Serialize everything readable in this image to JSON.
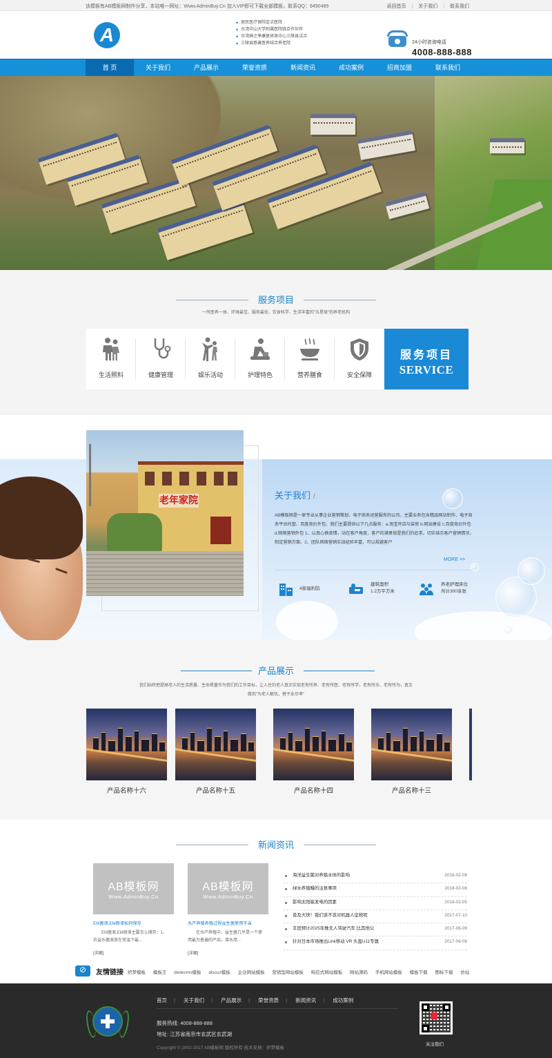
{
  "topbar": {
    "left_text": "该模板有AB模板网制作分享，本站唯一网址：Www.AdminBuy.Cn 加入VIP即可下载全部模板，联系QQ：9490489",
    "links": [
      "返回首页",
      "关于我们",
      "联系我们"
    ]
  },
  "header": {
    "logo_letter": "A",
    "tags": [
      "居民医疗保险定点医院",
      "台湾中山大学附属医院临合作伙伴",
      "台湾禅之季康复研发中心三陵县试点",
      "三陵县慈善医养结合养老院"
    ],
    "phone_label": "24小时咨询电话",
    "phone": "4008-888-888"
  },
  "nav": {
    "items": [
      "首 页",
      "关于我们",
      "产品展示",
      "荣誉资质",
      "新闻资讯",
      "成功案例",
      "招商加盟",
      "联系我们"
    ],
    "active_index": 0
  },
  "services": {
    "title": "服务项目",
    "subtitle": "一所医养一体、环境最佳、服务最优、饮食科学、生活丰富的\"五星级\"的养老机构",
    "items": [
      {
        "label": "生活照料",
        "icon": "people-icon"
      },
      {
        "label": "健康管理",
        "icon": "stethoscope-icon"
      },
      {
        "label": "娱乐活动",
        "icon": "dance-icon"
      },
      {
        "label": "护理特色",
        "icon": "nursing-icon"
      },
      {
        "label": "营养膳食",
        "icon": "meal-icon"
      },
      {
        "label": "安全保障",
        "icon": "shield-icon"
      }
    ],
    "banner_cn": "服务项目",
    "banner_en": "SERVICE"
  },
  "about": {
    "title": "关于我们",
    "slash": "/",
    "text": "AB模板网是一家专业从事企业营销策划、电子商务运营服务的公司，主要业务包含精品网站制作、电子商务平台托管、百度竞价外包、我们主要提供以下几点服务：a.淘宝开店与装修 b.网站建设 c.百度竞价外包 d.网络营销外包 1、以真心换真情，站在客户角度，客户的满意就是我们的追求，切实结合客户营销情况，制定营销方案。2、团队网络营销实战经验丰富，可以规避客户",
    "more": "MORE >>",
    "sign_text": "老年家院",
    "stats": [
      {
        "line1": "4家福利院",
        "line2": "",
        "icon": "building-icon"
      },
      {
        "line1": "建筑面积",
        "line2": "1.2万平方米",
        "icon": "bed-icon"
      },
      {
        "line1": "养老护理床位",
        "line2": "共计300余张",
        "icon": "group-icon"
      }
    ]
  },
  "products": {
    "title": "产品展示",
    "desc": "我们始终把提高老人的生活质量、生命质量作为我们的工作目标，让入住的老人真正实现老有所养、老有所医、老有所学、老有所乐、老有所为，真正做到\"为老人解忧，替子女尽孝\"",
    "items": [
      "产品名称十六",
      "产品名称十五",
      "产品名称十四",
      "产品名称十三"
    ]
  },
  "news": {
    "title": "新闻资讯",
    "thumbs": [
      {
        "t1": "AB模板网",
        "t2": "Www.AdminBuy.Cn",
        "title": "EM菌液,EM原液如何保存",
        "desc": "EM菌液,EM原液主要怎么储存：1、农益乐菌液放在常温下最...",
        "more": "[详细]"
      },
      {
        "t1": "AB模板网",
        "t2": "Www.AdminBuy.Cn",
        "title": "水产养殖养殖过程益生菌使用不当",
        "desc": "在水产养殖中，益生菌几乎是一个使用最为普遍的产品，增水用...",
        "more": "[详细]"
      }
    ],
    "list": [
      {
        "title": "海洋益生菌对养殖水体的影响",
        "date": "2018-02-08"
      },
      {
        "title": "绿水养殖鳗的注意事项",
        "date": "2018-02-08"
      },
      {
        "title": "影响太阳能发电的因素",
        "date": "2018-02-05"
      },
      {
        "title": "普及大快！我们该不该对机器人征税呢",
        "date": "2017-07-10"
      },
      {
        "title": "丰田预计2025年推无人驾驶汽车 比其他公",
        "date": "2017-06-09"
      },
      {
        "title": "针对日本市场推出Link移动 VR 头盔U11专属",
        "date": "2017-06-09"
      }
    ]
  },
  "links": {
    "title": "友情链接",
    "items": [
      "织梦模板",
      "模板王",
      "dedecms模板",
      "discuz模板",
      "企业网站模板",
      "营销型网站模板",
      "响应式网站模板",
      "网站源码",
      "手机网站模板",
      "模板下载",
      "图标下载",
      "仿站"
    ]
  },
  "footer": {
    "nav": [
      "首页",
      "关于我们",
      "产品展示",
      "荣誉资质",
      "新闻资讯",
      "成功案例"
    ],
    "hotline_label": "服务热线:",
    "hotline": "4008-888-888",
    "address_label": "地址:",
    "address": "江苏省南京市玄武区玄武湖",
    "copyright": "Copyright © 2002-2017 AB模板网 版权所有  技术支持：织梦模板",
    "qr_label": "关注我们"
  },
  "colors": {
    "accent": "#1690d8",
    "footer_bg": "#2a2a2a"
  }
}
